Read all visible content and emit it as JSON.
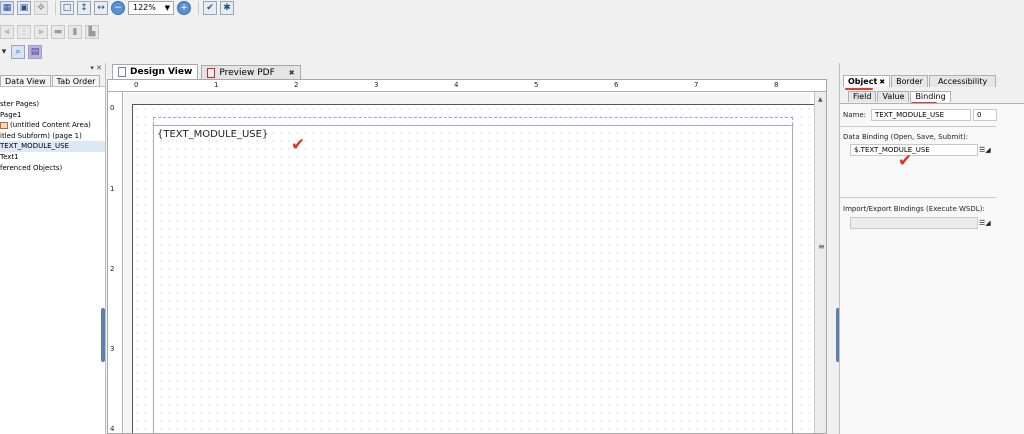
{
  "toolbar": {
    "zoom_value": "122%"
  },
  "left_panel": {
    "tabs": [
      "Data View",
      "Tab Order"
    ],
    "tree": [
      {
        "label": "ster Pages)"
      },
      {
        "label": "Page1"
      },
      {
        "label": "(untitled Content Area)"
      },
      {
        "label": "itled Subform) (page 1)"
      },
      {
        "label": "TEXT_MODULE_USE"
      },
      {
        "label": "Text1"
      },
      {
        "label": "ferenced Objects)"
      }
    ]
  },
  "center": {
    "tabs": [
      "Design View",
      "Preview PDF"
    ],
    "ruler_h": [
      "0",
      "1",
      "2",
      "3",
      "4",
      "5",
      "6",
      "7",
      "8"
    ],
    "ruler_v": [
      "0",
      "1",
      "2",
      "3",
      "4"
    ],
    "field_text": "{TEXT_MODULE_USE}"
  },
  "right_panel": {
    "tabs": [
      "Object",
      "Border",
      "Accessibility"
    ],
    "subtabs": [
      "Field",
      "Value",
      "Binding"
    ],
    "name_label": "Name:",
    "name_value": "TEXT_MODULE_USE",
    "name_index": "0",
    "binding_label": "Data Binding (Open, Save, Submit):",
    "binding_value": "$.TEXT_MODULE_USE",
    "import_label": "Import/Export Bindings (Execute WSDL):"
  },
  "accent_colors": {
    "annotation_red": "#e53b2f",
    "selection_blue": "#5b7fae"
  }
}
